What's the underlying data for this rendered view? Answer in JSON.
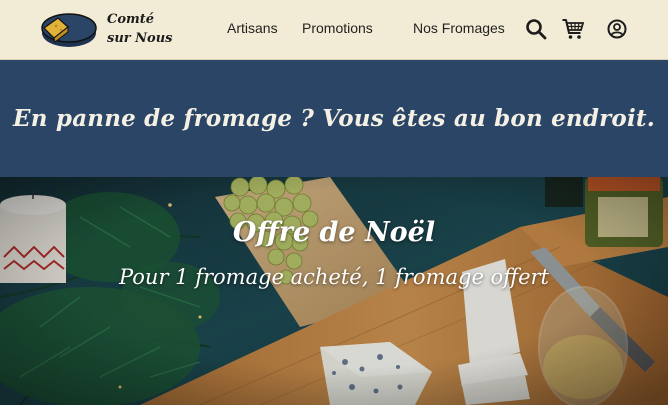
{
  "brand": {
    "logo_icon": "cheese-wheel-icon",
    "name_line1": "Comté",
    "name_line2": "sur Nous"
  },
  "nav": {
    "items": [
      {
        "label": "Artisans"
      },
      {
        "label": "Promotions"
      },
      {
        "label": "Nos Fromages"
      }
    ],
    "icons": [
      "search-icon",
      "cart-icon",
      "user-account-icon"
    ]
  },
  "tagline": {
    "text": "En panne de fromage ? Vous êtes au bon endroit."
  },
  "hero": {
    "title": "Offre de Noël",
    "subtitle": "Pour 1 fromage acheté, 1 fromage offert",
    "image": "christmas-cheese-board-photo"
  },
  "colors": {
    "header_bg": "#f2ecd6",
    "band_bg": "#2b4567",
    "logo_blue": "#2b4567",
    "logo_yellow": "#e0b23a",
    "text_light": "#ffffff"
  }
}
